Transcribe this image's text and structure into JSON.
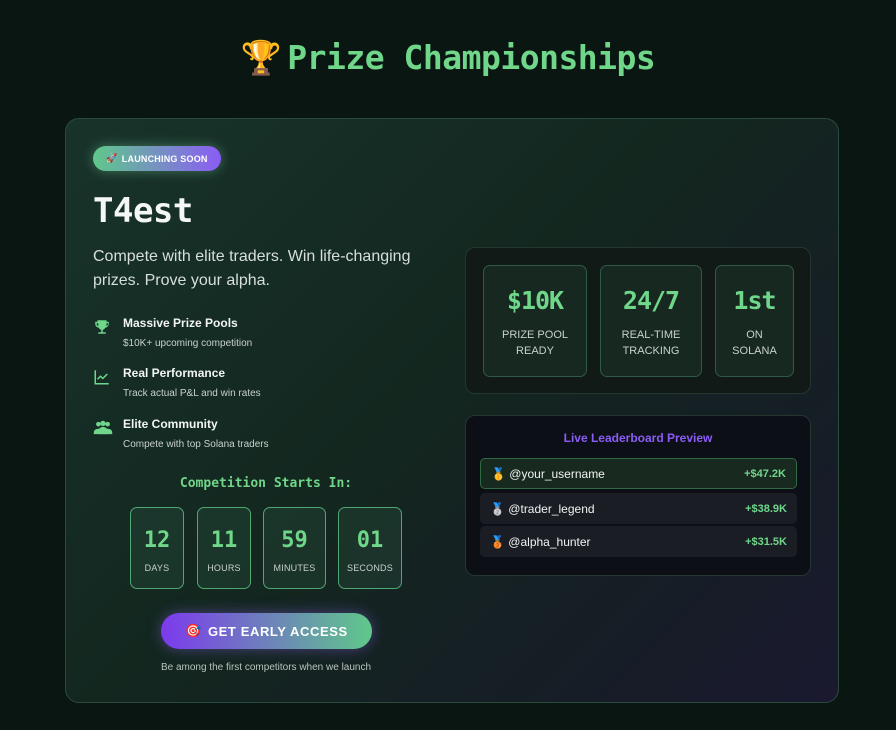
{
  "header": {
    "trophy": "🏆",
    "title": "Prize Championships"
  },
  "card": {
    "badge": {
      "icon": "🚀",
      "label": "LAUNCHING SOON"
    },
    "name": "T4est",
    "tagline": "Compete with elite traders. Win life-changing prizes. Prove your alpha.",
    "features": [
      {
        "icon": "trophy-icon",
        "title": "Massive Prize Pools",
        "desc": "$10K+ upcoming competition"
      },
      {
        "icon": "chart-line-icon",
        "title": "Real Performance",
        "desc": "Track actual P&L and win rates"
      },
      {
        "icon": "users-icon",
        "title": "Elite Community",
        "desc": "Compete with top Solana traders"
      }
    ],
    "countdown": {
      "title": "Competition Starts In:",
      "units": [
        {
          "value": "12",
          "label": "DAYS"
        },
        {
          "value": "11",
          "label": "HOURS"
        },
        {
          "value": "59",
          "label": "MINUTES"
        },
        {
          "value": "01",
          "label": "SECONDS"
        }
      ]
    },
    "cta": {
      "icon": "🎯",
      "label": "GET EARLY ACCESS",
      "subtext": "Be among the first competitors when we launch"
    },
    "stats": [
      {
        "value": "$10K",
        "label_line1": "PRIZE POOL",
        "label_line2": "READY"
      },
      {
        "value": "24/7",
        "label_line1": "REAL-TIME",
        "label_line2": "TRACKING"
      },
      {
        "value": "1st",
        "label_line1": "ON",
        "label_line2": "SOLANA"
      }
    ],
    "leaderboard": {
      "title": "Live Leaderboard Preview",
      "rows": [
        {
          "medal": "🥇",
          "user": "@your_username",
          "value": "+$47.2K"
        },
        {
          "medal": "🥈",
          "user": "@trader_legend",
          "value": "+$38.9K"
        },
        {
          "medal": "🥉",
          "user": "@alpha_hunter",
          "value": "+$31.5K"
        }
      ]
    }
  },
  "colors": {
    "accent_green": "#6fd68a",
    "accent_purple": "#8b5cf6",
    "background": "#0a1612"
  }
}
